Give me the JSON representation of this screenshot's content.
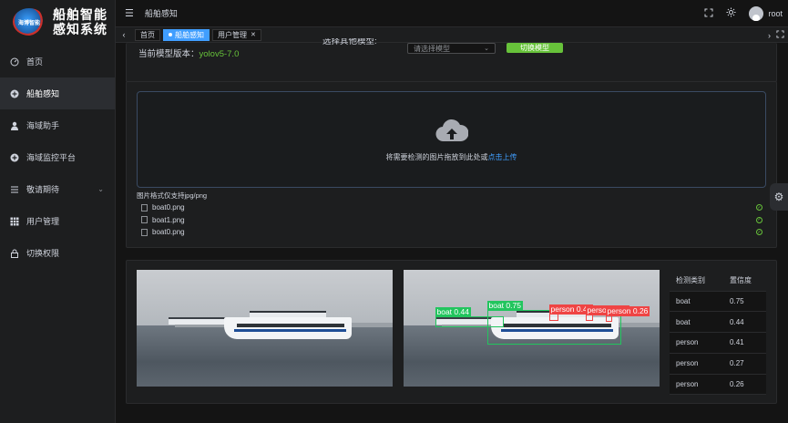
{
  "app": {
    "logo_badge": "海博智能",
    "logo_line1": "船舶智能",
    "logo_line2": "感知系统"
  },
  "sidebar": {
    "items": [
      {
        "label": "首页",
        "icon": "dashboard-icon"
      },
      {
        "label": "船舶感知",
        "icon": "plus-circle-icon"
      },
      {
        "label": "海域助手",
        "icon": "user-icon"
      },
      {
        "label": "海域监控平台",
        "icon": "plus-circle-icon"
      },
      {
        "label": "敬请期待",
        "icon": "list-icon"
      },
      {
        "label": "用户管理",
        "icon": "grid-icon"
      },
      {
        "label": "切换权限",
        "icon": "lock-icon"
      }
    ]
  },
  "header": {
    "breadcrumb": "船舶感知",
    "username": "root"
  },
  "tabs": [
    {
      "label": "首页"
    },
    {
      "label": "船舶感知"
    },
    {
      "label": "用户管理"
    }
  ],
  "model": {
    "current_label": "当前模型版本：",
    "current_value": "yolov5-7.0",
    "select_label": "选择其他模型:",
    "select_placeholder": "请选择模型",
    "switch_button": "切换模型"
  },
  "upload": {
    "hint_prefix": "将需要检测的图片拖放到此处或",
    "hint_link": "点击上传",
    "format_tip": "图片格式仅支持jpg/png",
    "files": [
      "boat0.png",
      "boat1.png",
      "boat0.png"
    ]
  },
  "detections": [
    {
      "label": "boat 0.75",
      "color": "#22c55e"
    },
    {
      "label": "boat 0.44",
      "color": "#22c55e"
    },
    {
      "label": "person 0.41",
      "color": "#ef4444"
    },
    {
      "label": "person 0.27",
      "color": "#ef4444"
    },
    {
      "label": "person 0.26",
      "color": "#ef4444"
    }
  ],
  "results": {
    "col_class": "检测类别",
    "col_conf": "置信度",
    "rows": [
      {
        "class": "boat",
        "conf": "0.75"
      },
      {
        "class": "boat",
        "conf": "0.44"
      },
      {
        "class": "person",
        "conf": "0.41"
      },
      {
        "class": "person",
        "conf": "0.27"
      },
      {
        "class": "person",
        "conf": "0.26"
      }
    ]
  },
  "colors": {
    "accent": "#409eff",
    "success": "#67c23a",
    "model_version": "#67c23a"
  }
}
